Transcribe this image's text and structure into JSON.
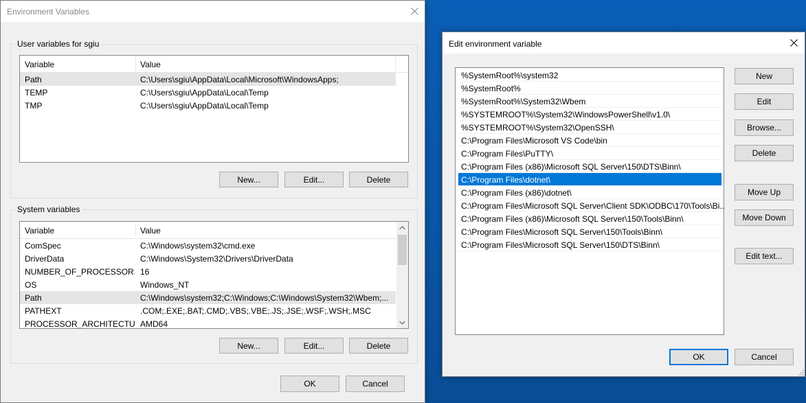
{
  "env_dialog": {
    "title": "Environment Variables",
    "user_group_label": "User variables for sgiu",
    "user_columns": [
      "Variable",
      "Value"
    ],
    "user_rows": [
      {
        "variable": "Path",
        "value": "C:\\Users\\sgiu\\AppData\\Local\\Microsoft\\WindowsApps;"
      },
      {
        "variable": "TEMP",
        "value": "C:\\Users\\sgiu\\AppData\\Local\\Temp"
      },
      {
        "variable": "TMP",
        "value": "C:\\Users\\sgiu\\AppData\\Local\\Temp"
      }
    ],
    "user_buttons": {
      "new": "New...",
      "edit": "Edit...",
      "delete": "Delete"
    },
    "system_group_label": "System variables",
    "system_columns": [
      "Variable",
      "Value"
    ],
    "system_rows": [
      {
        "variable": "ComSpec",
        "value": "C:\\Windows\\system32\\cmd.exe"
      },
      {
        "variable": "DriverData",
        "value": "C:\\Windows\\System32\\Drivers\\DriverData"
      },
      {
        "variable": "NUMBER_OF_PROCESSORS",
        "value": "16"
      },
      {
        "variable": "OS",
        "value": "Windows_NT"
      },
      {
        "variable": "Path",
        "value": "C:\\Windows\\system32;C:\\Windows;C:\\Windows\\System32\\Wbem;..."
      },
      {
        "variable": "PATHEXT",
        "value": ".COM;.EXE;.BAT;.CMD;.VBS;.VBE;.JS;.JSE;.WSF;.WSH;.MSC"
      },
      {
        "variable": "PROCESSOR_ARCHITECTURE",
        "value": "AMD64"
      }
    ],
    "system_buttons": {
      "new": "New...",
      "edit": "Edit...",
      "delete": "Delete"
    },
    "ok": "OK",
    "cancel": "Cancel"
  },
  "edit_dialog": {
    "title": "Edit environment variable",
    "entries": [
      "%SystemRoot%\\system32",
      "%SystemRoot%",
      "%SystemRoot%\\System32\\Wbem",
      "%SYSTEMROOT%\\System32\\WindowsPowerShell\\v1.0\\",
      "%SYSTEMROOT%\\System32\\OpenSSH\\",
      "C:\\Program Files\\Microsoft VS Code\\bin",
      "C:\\Program Files\\PuTTY\\",
      "C:\\Program Files (x86)\\Microsoft SQL Server\\150\\DTS\\Binn\\",
      "C:\\Program Files\\dotnet\\",
      "C:\\Program Files (x86)\\dotnet\\",
      "C:\\Program Files\\Microsoft SQL Server\\Client SDK\\ODBC\\170\\Tools\\Bi...",
      "C:\\Program Files (x86)\\Microsoft SQL Server\\150\\Tools\\Binn\\",
      "C:\\Program Files\\Microsoft SQL Server\\150\\Tools\\Binn\\",
      "C:\\Program Files\\Microsoft SQL Server\\150\\DTS\\Binn\\"
    ],
    "selected_index": 8,
    "buttons": {
      "new": "New",
      "edit": "Edit",
      "browse": "Browse...",
      "delete": "Delete",
      "move_up": "Move Up",
      "move_down": "Move Down",
      "edit_text": "Edit text..."
    },
    "ok": "OK",
    "cancel": "Cancel"
  },
  "colors": {
    "selection": "#0078d7",
    "desktop": "#0b56a8",
    "dialog_bg": "#f0f0f0"
  }
}
